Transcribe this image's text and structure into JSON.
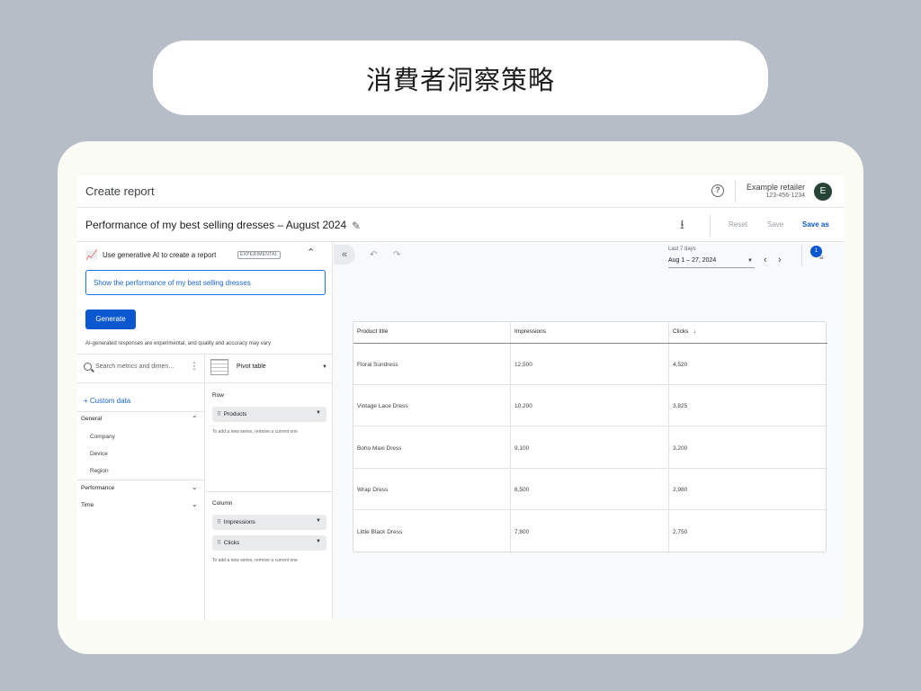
{
  "slide_title": "消費者洞察策略",
  "header": {
    "title": "Create report",
    "account_name": "Example retailer",
    "account_id": "123-456-1234",
    "avatar_letter": "E"
  },
  "report": {
    "name": "Performance of my best selling dresses – August 2024",
    "reset_label": "Reset",
    "save_label": "Save",
    "save_as_label": "Save as"
  },
  "ai_panel": {
    "label": "Use generative AI to create a report",
    "badge": "EXPERIMENTAL",
    "prompt_value": "Show the performance of my best selling dresses",
    "generate_label": "Generate",
    "disclaimer": "AI-generated responses are experimental, and quality and accuracy may vary"
  },
  "metrics_panel": {
    "search_placeholder": "Search metrics and dimen...",
    "custom_data_label": "+ Custom data",
    "groups": {
      "general": {
        "label": "General",
        "items": [
          "Company",
          "Device",
          "Region"
        ]
      },
      "performance": {
        "label": "Performance"
      },
      "time": {
        "label": "Time"
      }
    }
  },
  "viz_panel": {
    "type_label": "Pivot table",
    "row_label": "Row",
    "row_chips": [
      "Products"
    ],
    "row_hint": "To add a new series, remove a current one",
    "column_label": "Column",
    "column_chips": [
      "Impressions",
      "Clicks"
    ],
    "column_hint": "To add a new series, remove a current one"
  },
  "date_range": {
    "label": "Last 7 days",
    "value": "Aug 1 – 27, 2024"
  },
  "filter_count": "1",
  "table": {
    "columns": [
      "Product title",
      "Impressions",
      "Clicks"
    ],
    "sorted_column_arrow": "↓",
    "rows": [
      [
        "Floral Sundress",
        "12,500",
        "4,520"
      ],
      [
        "Vintage Lace Dress",
        "10,200",
        "3,825"
      ],
      [
        "Boho Maxi Dress",
        "9,100",
        "3,200"
      ],
      [
        "Wrap Dress",
        "8,500",
        "2,980"
      ],
      [
        "Little Black Dress",
        "7,800",
        "2,750"
      ]
    ]
  },
  "colors": {
    "accent": "#0b57d0",
    "link": "#1967d2",
    "avatar_bg": "#264537",
    "page_bg": "#b7bdc6"
  }
}
